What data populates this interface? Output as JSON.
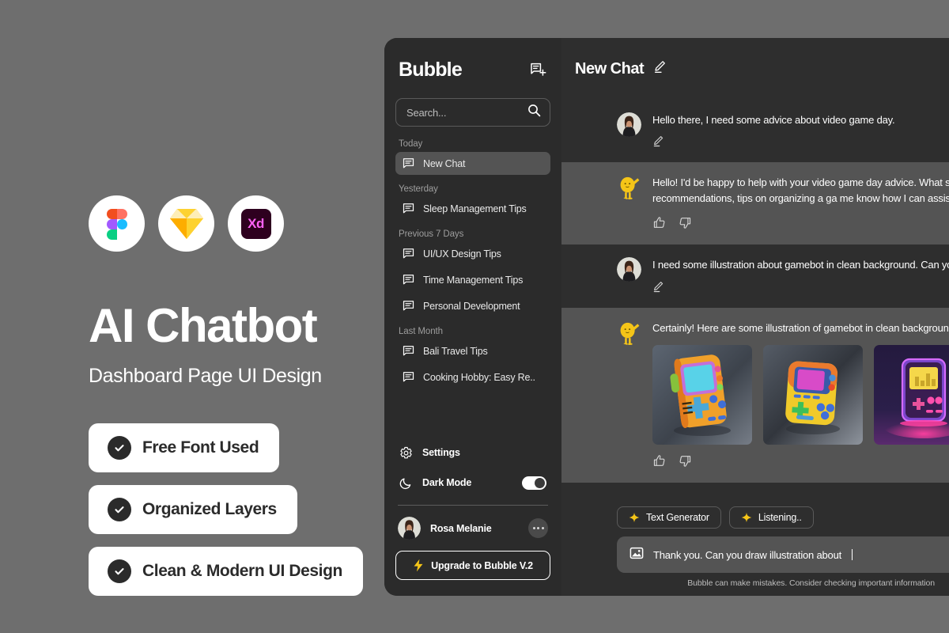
{
  "promo": {
    "title": "AI Chatbot",
    "subtitle": "Dashboard Page UI Design",
    "tools": [
      {
        "name": "figma-logo",
        "label": "Figma"
      },
      {
        "name": "sketch-logo",
        "label": "Sketch"
      },
      {
        "name": "adobe-xd-logo",
        "label": "Xd"
      }
    ],
    "badges": [
      {
        "label": "Free Font Used"
      },
      {
        "label": "Organized Layers"
      },
      {
        "label": "Clean & Modern UI Design"
      }
    ],
    "background_color": "#6e6e6e",
    "badge_color": "#ffffff"
  },
  "sidebar": {
    "brand": "Bubble",
    "new_chat_icon": "new-chat-icon",
    "search": {
      "placeholder": "Search...",
      "value": "",
      "icon": "search-icon"
    },
    "groups": [
      {
        "label": "Today",
        "items": [
          {
            "label": "New Chat",
            "active": true
          }
        ]
      },
      {
        "label": "Yesterday",
        "items": [
          {
            "label": "Sleep Management Tips",
            "active": false
          }
        ]
      },
      {
        "label": "Previous 7 Days",
        "items": [
          {
            "label": "UI/UX Design Tips",
            "active": false
          },
          {
            "label": "Time Management Tips",
            "active": false
          },
          {
            "label": "Personal Development",
            "active": false
          }
        ]
      },
      {
        "label": "Last Month",
        "items": [
          {
            "label": "Bali Travel Tips",
            "active": false
          },
          {
            "label": "Cooking Hobby: Easy Re..",
            "active": false
          }
        ]
      }
    ],
    "settings_label": "Settings",
    "dark_mode_label": "Dark Mode",
    "dark_mode_on": true,
    "user_name": "Rosa Melanie",
    "upgrade_label": "Upgrade to Bubble V.2",
    "active_item_color": "#545454"
  },
  "chat": {
    "title": "New Chat",
    "edit_icon": "pencil-icon",
    "messages": [
      {
        "role": "user",
        "text": "Hello there, I need some advice about video game day.",
        "has_edit": true
      },
      {
        "role": "bot",
        "text": "Hello! I'd be happy to help with your video game day advice. What s Are you looking for game recommendations, tips on organizing a ga me know how I can assist you!",
        "has_feedback": true
      },
      {
        "role": "user",
        "text": "I need some illustration about gamebot in clean background. Can yo",
        "has_edit": true
      },
      {
        "role": "bot",
        "text": "Certainly! Here are some illustration of gamebot in clean backgroun",
        "has_feedback": true,
        "images": [
          {
            "alt": "orange handheld gamebot"
          },
          {
            "alt": "yellow handheld gamebot"
          },
          {
            "alt": "neon purple gamebot"
          }
        ]
      }
    ],
    "chips": [
      {
        "label": "Text Generator",
        "icon": "sparkle-icon"
      },
      {
        "label": "Listening..",
        "icon": "sparkle-icon"
      }
    ],
    "input": {
      "value": "Thank you. Can you draw illustration about",
      "icon": "image-icon"
    },
    "disclaimer": "Bubble can make mistakes. Consider checking important information",
    "row_dark_color": "#2e2e2e",
    "row_light_color": "#545454",
    "accent_color": "#f5c518"
  }
}
